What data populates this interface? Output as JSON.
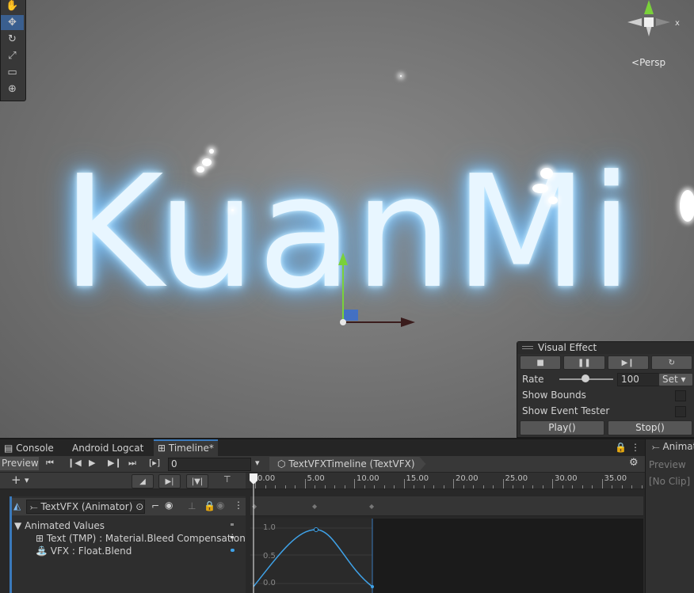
{
  "scene": {
    "glow_text": "KuanMi",
    "persp_label": "Persp",
    "gizmo_axis_x": "x"
  },
  "tools": [
    {
      "name": "hand-tool-icon",
      "glyph": "✋"
    },
    {
      "name": "move-tool-icon",
      "glyph": "✥"
    },
    {
      "name": "rotate-tool-icon",
      "glyph": "↻"
    },
    {
      "name": "scale-tool-icon",
      "glyph": "⤢"
    },
    {
      "name": "rect-tool-icon",
      "glyph": "▭"
    },
    {
      "name": "transform-tool-icon",
      "glyph": "⊕"
    }
  ],
  "visual_effect": {
    "title": "Visual Effect",
    "rate_label": "Rate",
    "rate_value": "100",
    "set_label": "Set",
    "show_bounds": "Show Bounds",
    "show_event_tester": "Show Event Tester",
    "play": "Play()",
    "stop": "Stop()"
  },
  "tabs": {
    "console": "Console",
    "logcat": "Android Logcat",
    "timeline": "Timeline*",
    "animation": "Animat"
  },
  "timeline": {
    "preview": "Preview",
    "frame": "0",
    "asset": "TextVFXTimeline (TextVFX)",
    "track_name": "TextVFX (Animator)",
    "animated_values": "Animated Values",
    "prop1": "Text (TMP) : Material.Bleed Compensation",
    "prop2": "VFX : Float.Blend",
    "ruler_labels": [
      "0.00",
      "5.00",
      "10.00",
      "15.00",
      "20.00",
      "25.00",
      "30.00",
      "35.00"
    ],
    "curve_labels": [
      "1.0",
      "0.5",
      "0.0"
    ]
  },
  "animation_panel": {
    "preview": "Preview",
    "no_clip": "[No Clip]"
  },
  "colors": {
    "accent": "#3a79bb",
    "curve": "#3fa2e8",
    "glow": "#7cc4ff"
  }
}
